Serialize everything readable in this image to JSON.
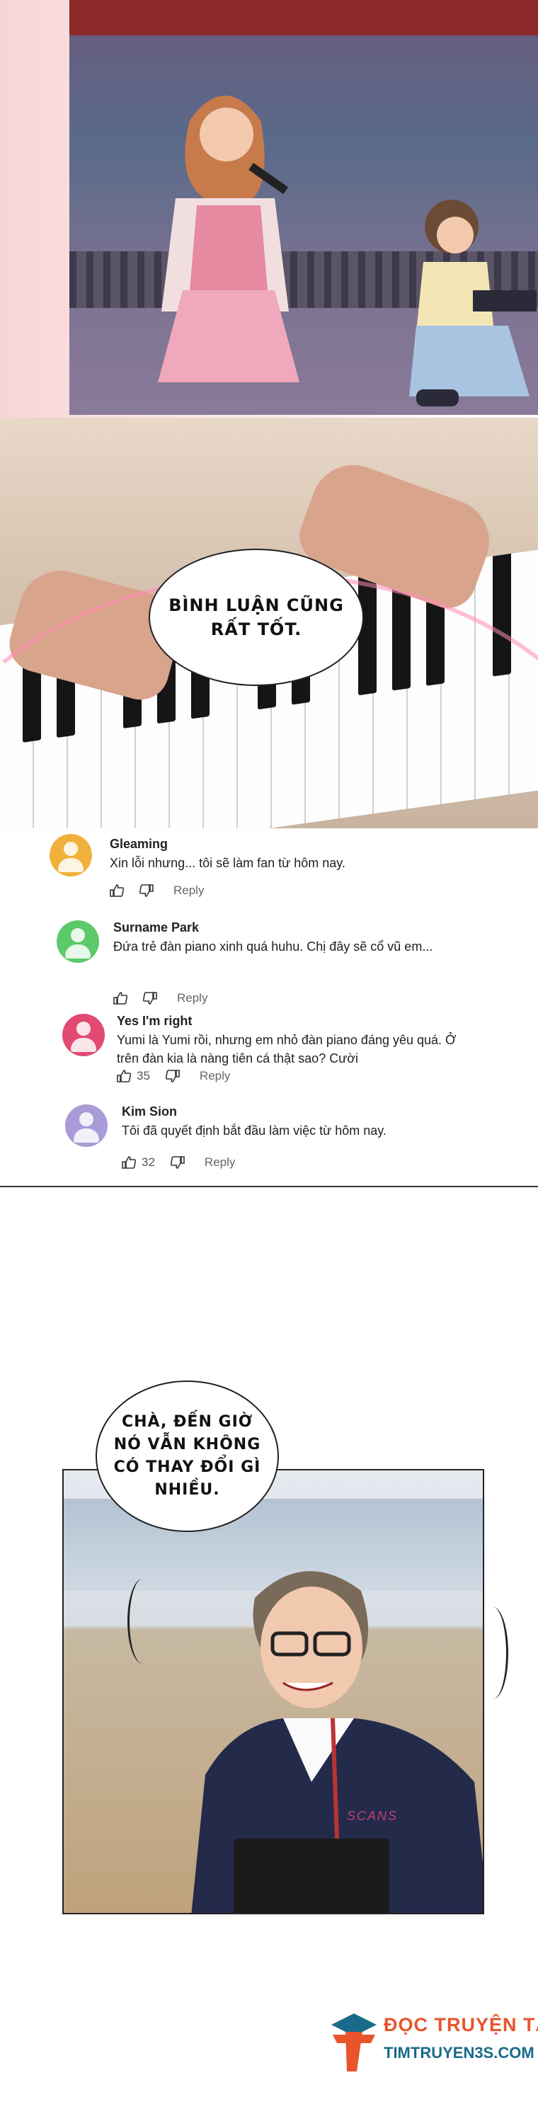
{
  "panel_top": {
    "scene": "concert-singer-and-pianist"
  },
  "panel_keys": {
    "bubble_text": "BÌNH LUẬN CŨNG\nRẤT TỐT."
  },
  "comments": [
    {
      "name": "Gleaming",
      "text": "Xin lỗi nhưng... tôi sẽ làm fan từ hôm nay.",
      "likes": "",
      "reply": "Reply",
      "avatar_color": "#f0b13c"
    },
    {
      "name": "Surname Park",
      "text": "Đứa trẻ đàn piano xinh quá huhu. Chị đây sẽ cổ vũ em...",
      "likes": "",
      "reply": "Reply",
      "avatar_color": "#5cc96a"
    },
    {
      "name": "Yes I'm right",
      "text": "Yumi là Yumi rồi, nhưng em nhỏ đàn piano đáng yêu quá. Ở trên đàn kia là nàng tiên cá thật sao? Cười",
      "likes": "35",
      "reply": "Reply",
      "avatar_color": "#e14a73"
    },
    {
      "name": "Kim Sion",
      "text": "Tôi đã quyết định bắt đầu làm việc từ hôm nay.",
      "likes": "32",
      "reply": "Reply",
      "avatar_color": "#a99ad8"
    }
  ],
  "panel_teacher": {
    "bubble_text": "CHÀ, ĐẾN GIỜ\nNÓ VẪN KHÔNG\nCÓ THAY ĐỔI GÌ\nNHIỀU.",
    "scan_watermark": "SCANS"
  },
  "watermark": {
    "line1": "ĐỌC TRUYỆN TẠI",
    "line2": "TIMTRUYEN3S.COM",
    "logo_icon": "t-logo-icon"
  },
  "colors": {
    "accent_orange": "#e8552b",
    "accent_blue": "#1a6b8a"
  }
}
